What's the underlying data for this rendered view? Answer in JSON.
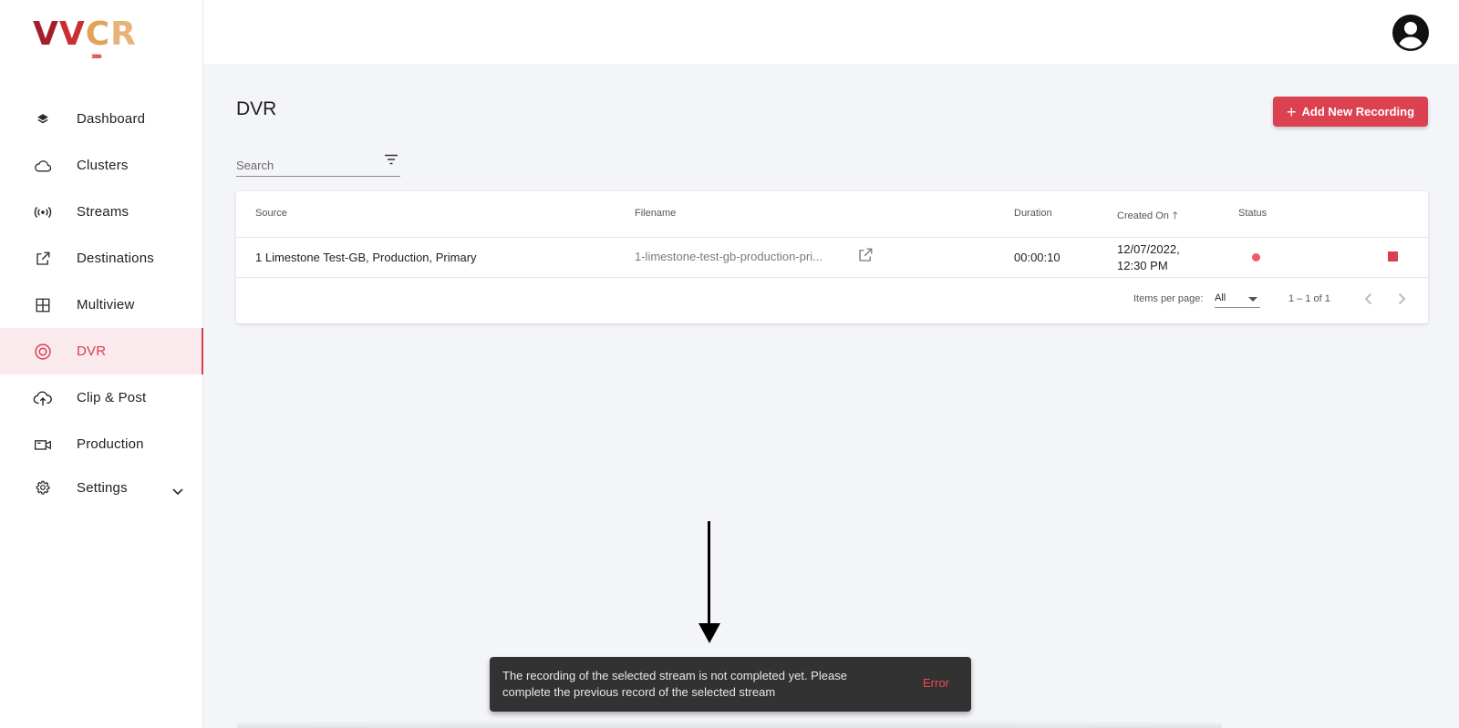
{
  "brand": {
    "logo_letters": [
      "V",
      "V",
      "C",
      "R"
    ],
    "logo_arrows": "››››››"
  },
  "sidebar": {
    "items": [
      {
        "label": "Dashboard",
        "icon": "layers-icon",
        "active": false
      },
      {
        "label": "Clusters",
        "icon": "cloud-icon",
        "active": false
      },
      {
        "label": "Streams",
        "icon": "broadcast-icon",
        "active": false
      },
      {
        "label": "Destinations",
        "icon": "open-external-icon",
        "active": false
      },
      {
        "label": "Multiview",
        "icon": "grid-icon",
        "active": false
      },
      {
        "label": "DVR",
        "icon": "record-icon",
        "active": true
      },
      {
        "label": "Clip & Post",
        "icon": "cloud-upload-icon",
        "active": false
      },
      {
        "label": "Production",
        "icon": "video-camera-icon",
        "active": false
      },
      {
        "label": "Settings",
        "icon": "gear-icon",
        "active": false,
        "expandable": true
      }
    ]
  },
  "header": {
    "avatar_icon": "account-circle-icon"
  },
  "main": {
    "title": "DVR",
    "add_button": "Add New Recording",
    "search": {
      "placeholder": "Search",
      "value": ""
    },
    "table": {
      "columns": [
        "Source",
        "Filename",
        "Duration",
        "Created On",
        "Status"
      ],
      "sort": {
        "column": "Created On",
        "direction": "ascending"
      },
      "rows": [
        {
          "source": "1 Limestone Test-GB, Production, Primary",
          "filename": "1-limestone-test-gb-production-pri...",
          "duration": "00:00:10",
          "created_date": "12/07/2022,",
          "created_time": "12:30 PM",
          "status": "recording"
        }
      ],
      "paginator": {
        "items_per_page_label": "Items per page:",
        "items_per_page_value": "All",
        "range": "1 – 1 of 1"
      }
    }
  },
  "snackbar": {
    "message": "The recording of the selected stream is not completed yet. Please complete the previous record of the selected stream",
    "action": "Error"
  },
  "colors": {
    "accent": "#dc4150",
    "active_bg": "#fbeaed",
    "status_dot": "#ee5a66",
    "snackbar_bg": "#323232"
  }
}
